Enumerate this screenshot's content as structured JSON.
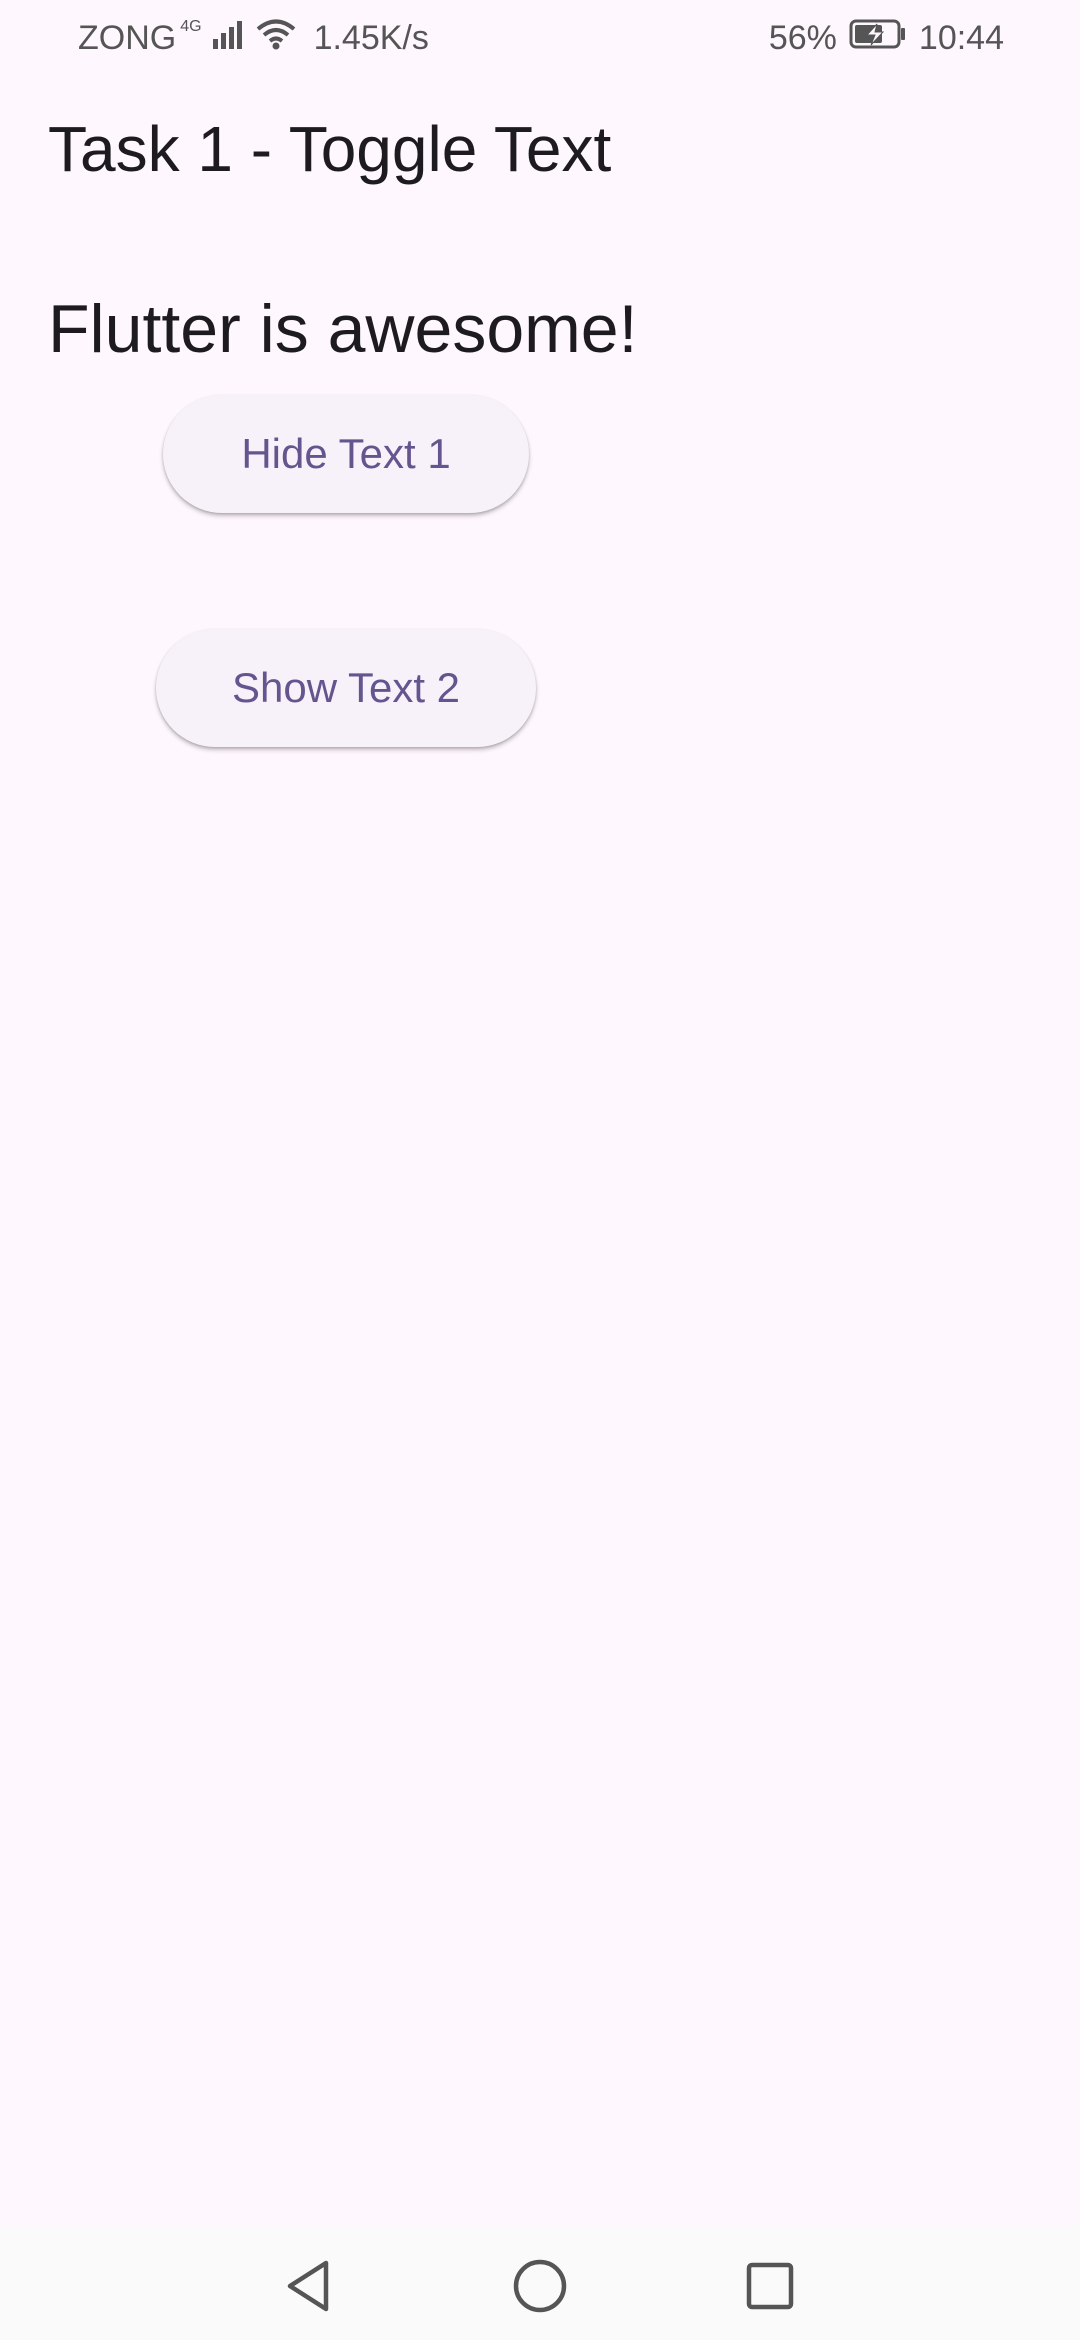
{
  "status_bar": {
    "carrier": "ZONG",
    "network_type": "4G",
    "net_speed": "1.45K/s",
    "battery_percent": "56%",
    "time": "10:44",
    "icons": [
      "signal-icon",
      "wifi-icon",
      "battery-charging-icon"
    ]
  },
  "app": {
    "title": "Task 1 - Toggle Text",
    "text1": "Flutter is awesome!",
    "hide_button_label": "Hide Text 1",
    "show_button_label": "Show Text 2"
  },
  "nav_bar": {
    "icons": [
      "back-icon",
      "home-icon",
      "recent-apps-icon"
    ]
  },
  "colors": {
    "background": "#fef7fd",
    "button_background": "#f7f2fa",
    "button_text": "#65558f",
    "title_text": "#1d1b20"
  }
}
